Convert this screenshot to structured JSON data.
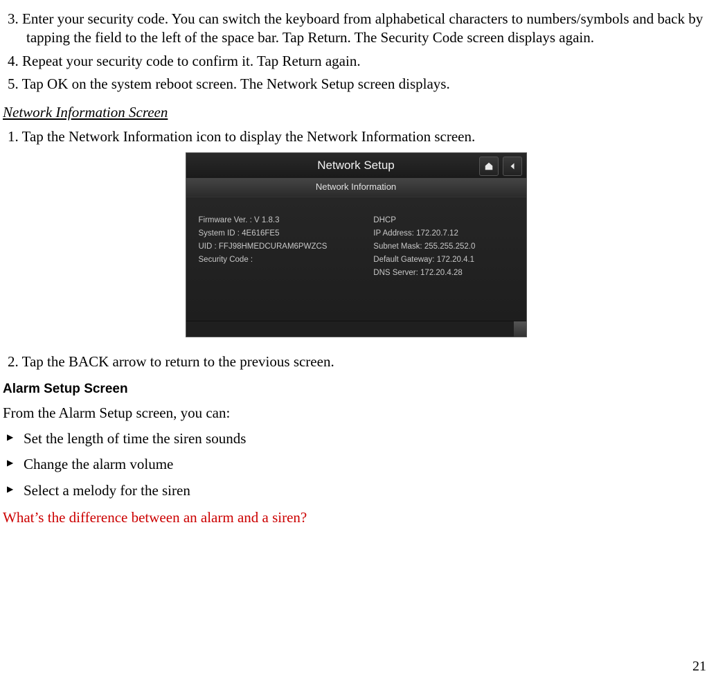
{
  "steps_first": [
    {
      "num": "3.",
      "text": "Enter your security code. You can switch the keyboard from alphabetical characters to numbers/symbols and back by tapping the field to the left of the space bar. Tap Return. The Security Code screen displays again."
    },
    {
      "num": "4.",
      "text": "Repeat your security code to confirm it. Tap Return again."
    },
    {
      "num": "5.",
      "text": "Tap OK on the system reboot screen. The Network Setup screen displays."
    }
  ],
  "network_heading": "Network Information Screen",
  "network_step1": {
    "num": "1.",
    "text": "Tap the Network Information icon to display the Network Information screen."
  },
  "network_step2": {
    "num": "2.",
    "text": "Tap the BACK arrow to return to the previous screen."
  },
  "device": {
    "title": "Network Setup",
    "subtitle": "Network Information",
    "left": {
      "firmware_label": "Firmware Ver. :",
      "firmware_value": "V 1.8.3",
      "system_id_label": "System ID :",
      "system_id_value": "4E616FE5",
      "uid_label": "UID :",
      "uid_value": "FFJ98HMEDCURAM6PWZCS",
      "security_code_label": "Security Code :",
      "security_code_value": ""
    },
    "right": {
      "dhcp_label": "DHCP",
      "ip_label": "IP  Address:",
      "ip_value": "172.20.7.12",
      "subnet_label": "Subnet Mask:",
      "subnet_value": "255.255.252.0",
      "gateway_label": "Default Gateway:",
      "gateway_value": "172.20.4.1",
      "dns_label": "DNS Server:",
      "dns_value": "172.20.4.28"
    }
  },
  "alarm_heading": "Alarm Setup Screen",
  "alarm_intro": "From the Alarm Setup screen, you can:",
  "alarm_bullets": [
    "Set the length of time the siren sounds",
    "Change the alarm volume",
    "Select a melody for the siren"
  ],
  "red_question": "What’s the difference between an alarm and a siren?",
  "page_number": "21"
}
